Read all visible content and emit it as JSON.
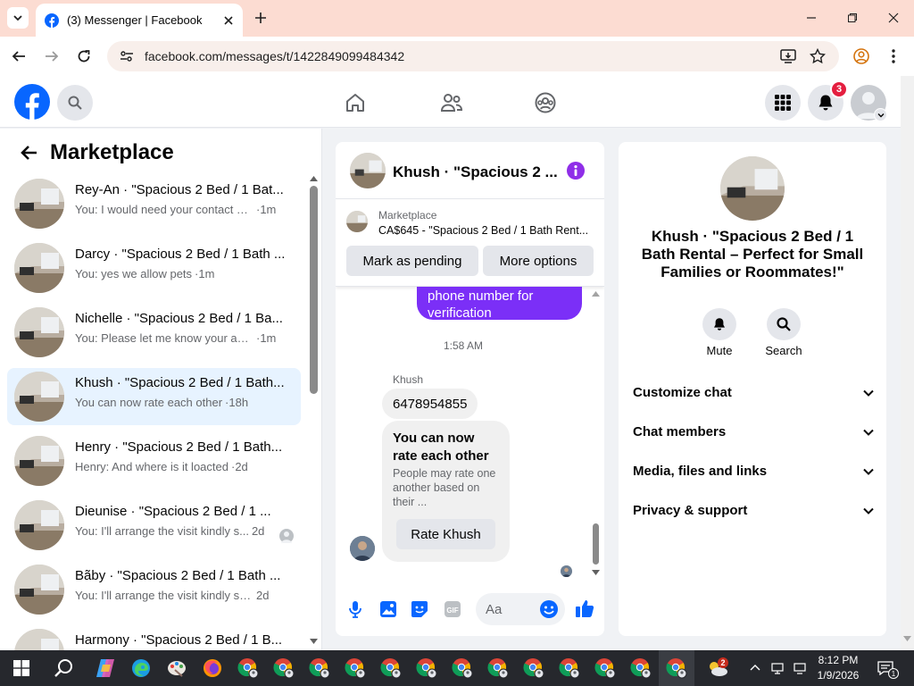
{
  "browser": {
    "tab_title": "(3) Messenger | Facebook",
    "url": "facebook.com/messages/t/1422849099484342"
  },
  "header": {
    "notifications_badge": "3"
  },
  "left": {
    "title": "Marketplace",
    "conversations": [
      {
        "name": "Rey-An · \"Spacious 2 Bed / 1 Bat...",
        "preview": "You: I would need your contact nu...",
        "time": "·1m"
      },
      {
        "name": "Darcy · \"Spacious 2 Bed / 1 Bath ...",
        "preview": "You: yes we allow pets",
        "time": "·1m"
      },
      {
        "name": "Nichelle · \"Spacious 2 Bed / 1 Ba...",
        "preview": "You: Please let me know your avail...",
        "time": "·1m"
      },
      {
        "name": "Khush · \"Spacious 2 Bed / 1 Bath...",
        "preview": "You can now rate each other",
        "time": "·18h"
      },
      {
        "name": "Henry · \"Spacious 2 Bed / 1 Bath...",
        "preview": "Henry: And where is it loacted",
        "time": "·2d"
      },
      {
        "name": "Dieunise · \"Spacious 2 Bed / 1 ...",
        "preview": "You: I'll arrange the visit kindly s...",
        "time": "2d"
      },
      {
        "name": "Bãby · \"Spacious 2 Bed / 1 Bath ...",
        "preview": "You: I'll arrange the visit kindly sen...",
        "time": "2d"
      },
      {
        "name": "Harmony · \"Spacious 2 Bed / 1 B...",
        "preview": "",
        "time": ""
      }
    ]
  },
  "chat": {
    "title": "Khush · \"Spacious 2 ...",
    "listing_label": "Marketplace",
    "listing_text": "CA$645 - \"Spacious 2 Bed / 1 Bath Rent...",
    "mark_pending": "Mark as pending",
    "more_options": "More options",
    "sent_bubble_line1": "phone number for",
    "sent_bubble_line2": "verification",
    "timestamp": "1:58 AM",
    "sender": "Khush",
    "phone_message": "6478954855",
    "rate_title": "You can now rate each other",
    "rate_body": "People may rate one another based on their ...",
    "rate_button": "Rate Khush",
    "input_placeholder": "Aa"
  },
  "right": {
    "title": "Khush · \"Spacious 2 Bed / 1 Bath Rental – Perfect for Small Families or Roommates!\"",
    "mute": "Mute",
    "search": "Search",
    "sections": [
      "Customize chat",
      "Chat members",
      "Media, files and links",
      "Privacy & support"
    ]
  },
  "taskbar": {
    "time": "8:12 PM",
    "date": "1/9/2026",
    "weather_badge": "2",
    "notif_badge": "1"
  },
  "colors": {
    "fb_blue": "#0866ff",
    "messenger_purple": "#7b2ff7",
    "badge_red": "#e41e3f",
    "selected_bg": "#e7f3ff"
  }
}
